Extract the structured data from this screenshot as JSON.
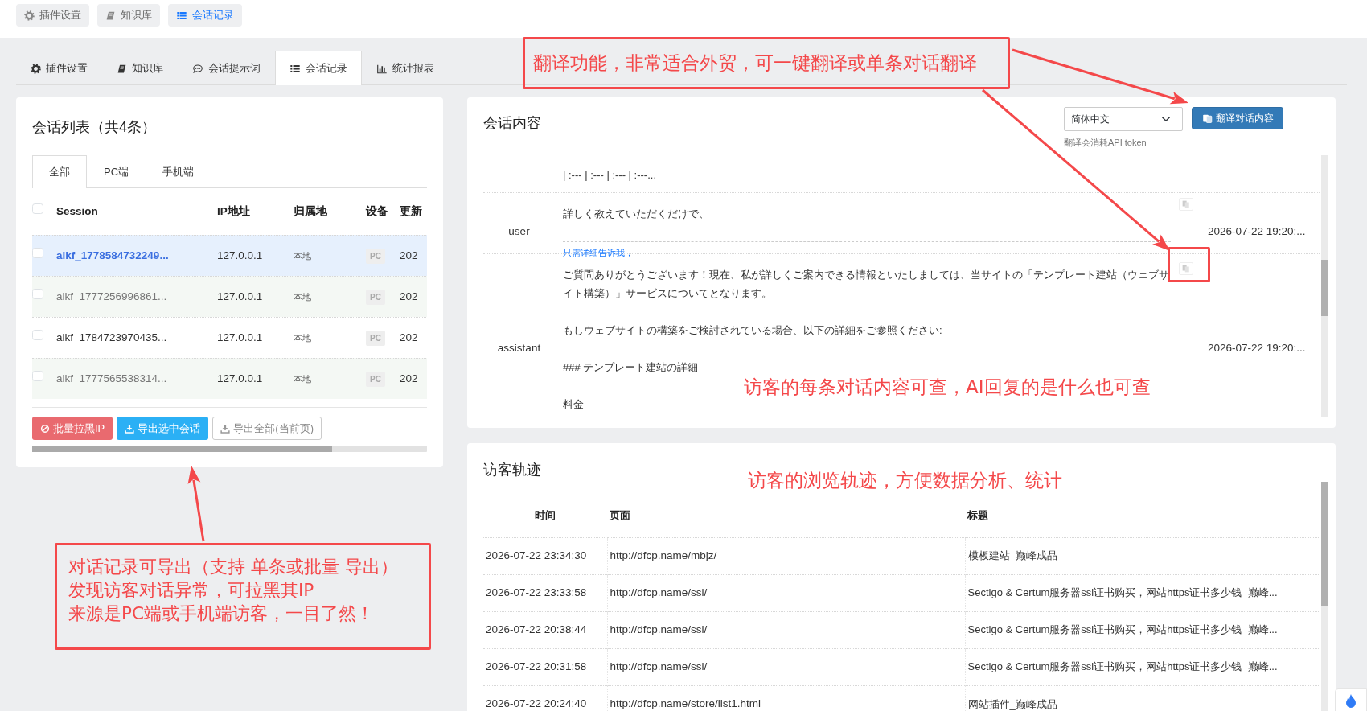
{
  "top_buttons": [
    {
      "label": "插件设置",
      "selected": false
    },
    {
      "label": "知识库",
      "selected": false
    },
    {
      "label": "会话记录",
      "selected": true
    }
  ],
  "main_tabs": [
    {
      "label": "插件设置",
      "selected": false
    },
    {
      "label": "知识库",
      "selected": false
    },
    {
      "label": "会话提示词",
      "selected": false
    },
    {
      "label": "会话记录",
      "selected": true
    },
    {
      "label": "统计报表",
      "selected": false
    }
  ],
  "session_list": {
    "title": "会话列表（共4条）",
    "filter_tabs": [
      {
        "label": "全部",
        "selected": true
      },
      {
        "label": "PC端",
        "selected": false
      },
      {
        "label": "手机端",
        "selected": false
      }
    ],
    "all_checked": false,
    "columns": [
      "Session",
      "IP地址",
      "归属地",
      "设备",
      "更新"
    ],
    "rows": [
      {
        "session": "aikf_1778584732249...",
        "ip": "127.0.0.1",
        "location": "本地",
        "device": "PC",
        "updated": "202",
        "selected": true,
        "checked": false
      },
      {
        "session": "aikf_1777256996861...",
        "ip": "127.0.0.1",
        "location": "本地",
        "device": "PC",
        "updated": "202",
        "selected": false,
        "checked": false
      },
      {
        "session": "aikf_1784723970435...",
        "ip": "127.0.0.1",
        "location": "本地",
        "device": "PC",
        "updated": "202",
        "selected": false,
        "checked": false
      },
      {
        "session": "aikf_1777565538314...",
        "ip": "127.0.0.1",
        "location": "本地",
        "device": "PC",
        "updated": "202",
        "selected": false,
        "checked": false
      }
    ],
    "actions": [
      {
        "label": "批量拉黑IP",
        "kind": "danger"
      },
      {
        "label": "导出选中会话",
        "kind": "primary"
      },
      {
        "label": "导出全部(当前页)",
        "kind": "outline"
      }
    ]
  },
  "conversation": {
    "title": "会话内容",
    "language": "简体中文",
    "translate_button": "翻译对话内容",
    "hint": "翻译会消耗API token",
    "messages": [
      {
        "paragraphs": [
          "| :--- | :--- | :--- | :---..."
        ],
        "translatable": false
      },
      {
        "role": "user",
        "paragraphs": [
          "詳しく教えていただくだけで、"
        ],
        "translation": "只需详细告诉我，",
        "time": "2026-07-22 19:20:...",
        "translatable": true
      },
      {
        "role": "assistant",
        "paragraphs": [
          "ご質問ありがとうございます！現在、私が詳しくご案内できる情報といたしましては、当サイトの「テンプレート建站（ウェブサイト構築）」サービスについてとなります。",
          "もしウェブサイトの構築をご検討されている場合、以下の詳細をご参照ください:",
          "### テンプレート建站の詳細",
          "料金"
        ],
        "time": "2026-07-22 19:20:...",
        "translatable": true
      }
    ]
  },
  "visitor_trail": {
    "title": "访客轨迹",
    "columns": [
      "时间",
      "页面",
      "标题"
    ],
    "rows": [
      {
        "time": "2026-07-22 23:34:30",
        "page": "http://dfcp.name/mbjz/",
        "title": "模板建站_巅峰成品"
      },
      {
        "time": "2026-07-22 23:33:58",
        "page": "http://dfcp.name/ssl/",
        "title": "Sectigo & Certum服务器ssl证书购买，网站https证书多少钱_巅峰..."
      },
      {
        "time": "2026-07-22 20:38:44",
        "page": "http://dfcp.name/ssl/",
        "title": "Sectigo & Certum服务器ssl证书购买，网站https证书多少钱_巅峰..."
      },
      {
        "time": "2026-07-22 20:31:58",
        "page": "http://dfcp.name/ssl/",
        "title": "Sectigo & Certum服务器ssl证书购买，网站https证书多少钱_巅峰..."
      },
      {
        "time": "2026-07-22 20:24:40",
        "page": "http://dfcp.name/store/list1.html",
        "title": "网站插件_巅峰成品"
      }
    ]
  },
  "annotations": [
    {
      "kind": "boxed",
      "lines": [
        "翻译功能，非常适合外贸，可一键翻译或单条对话翻译"
      ]
    },
    {
      "kind": "plain",
      "lines": [
        "访客的每条对话内容可查，AI回复的是什么也可查"
      ]
    },
    {
      "kind": "plain",
      "lines": [
        "访客的浏览轨迹，方便数据分析、统计"
      ]
    },
    {
      "kind": "boxed",
      "lines": [
        "对话记录可导出（支持 单条或批量 导出）",
        "发现访客对话异常，可拉黑其IP",
        "来源是PC端或手机端访客，一目了然！"
      ]
    }
  ]
}
